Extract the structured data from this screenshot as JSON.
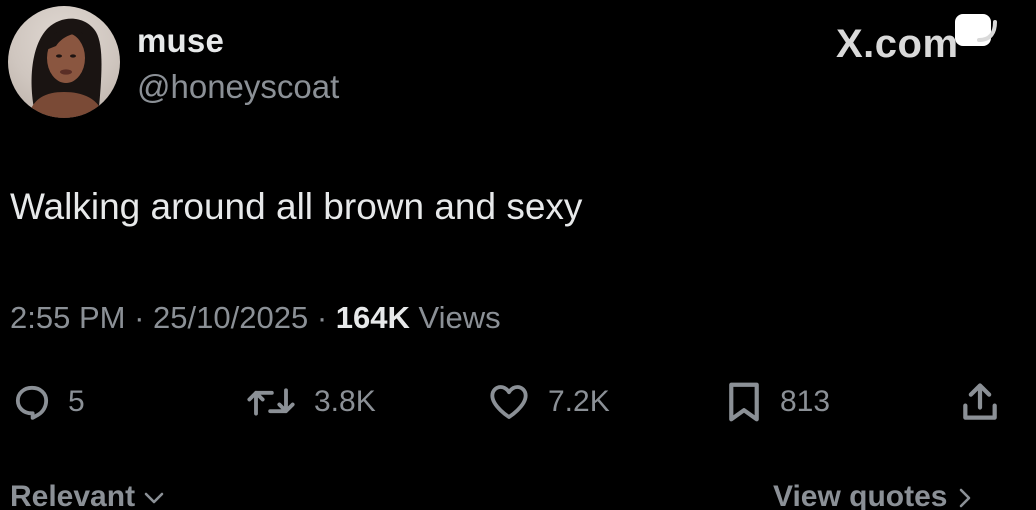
{
  "user": {
    "display_name": "muse",
    "handle": "@honeyscoat"
  },
  "watermark": "X.com",
  "tweet": {
    "text": "Walking around all brown and sexy",
    "time": "2:55 PM",
    "separator": "·",
    "date": "25/10/2025",
    "views_count": "164K",
    "views_label": "Views"
  },
  "actions": {
    "replies": "5",
    "reposts": "3.8K",
    "likes": "7.2K",
    "bookmarks": "813"
  },
  "footer": {
    "sort_label": "Relevant",
    "quotes_label": "View quotes"
  },
  "icons": {
    "reply": "reply-icon",
    "repost": "repost-icon",
    "like": "heart-icon",
    "bookmark": "bookmark-icon",
    "share": "share-icon",
    "sort": "chevron-down-icon",
    "quotes": "chevron-right-icon",
    "watermark_badge": "toggle-icon"
  },
  "colors": {
    "background": "#000000",
    "text_primary": "#e7e9ea",
    "text_secondary": "#8b9096"
  }
}
